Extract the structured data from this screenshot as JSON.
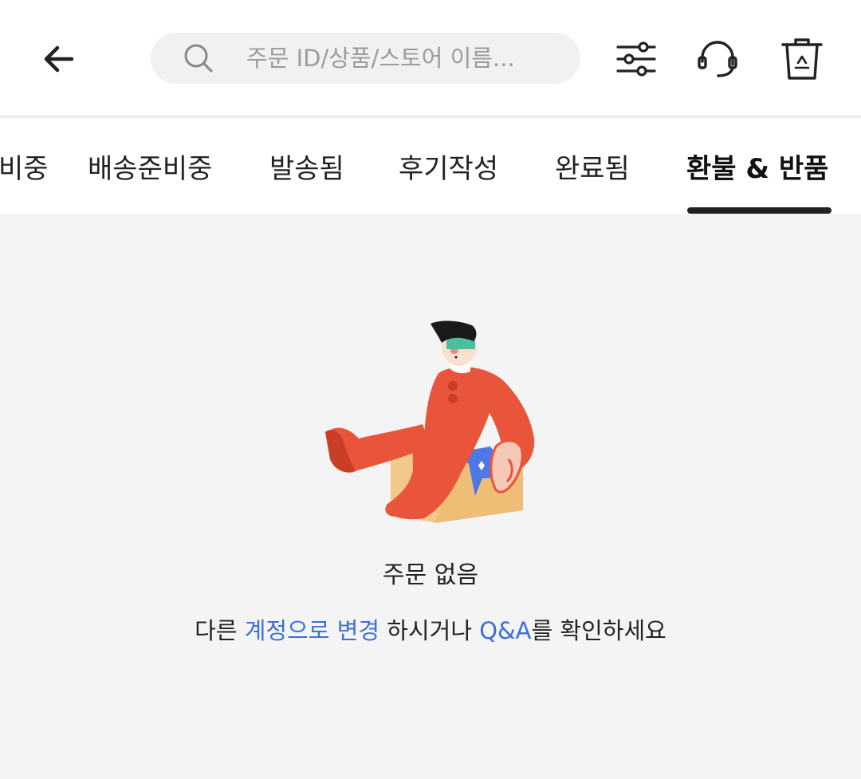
{
  "header": {
    "search_placeholder": "주문 ID/상품/스토어 이름...",
    "icons": [
      "back-arrow-icon",
      "search-icon",
      "filter-sliders-icon",
      "headset-support-icon",
      "recycle-bin-icon"
    ]
  },
  "tabs": [
    {
      "label": "비중"
    },
    {
      "label": "배송준비중"
    },
    {
      "label": "발송됨"
    },
    {
      "label": "후기작성"
    },
    {
      "label": "완료됨"
    },
    {
      "label": "환불 & 반품"
    }
  ],
  "active_tab": "환불 & 반품",
  "empty": {
    "title": "주문 없음",
    "desc_prefix": "다른 ",
    "change_account_link": "계정으로 변경",
    "desc_middle": " 하시거나 ",
    "qa_link": "Q&A",
    "desc_suffix": "를 확인하세요"
  },
  "colors": {
    "link": "#3d6fd6",
    "active_underline": "#222222",
    "background": "#f4f4f4",
    "figure_suit": "#e8553a",
    "box": "#f3c98b"
  }
}
